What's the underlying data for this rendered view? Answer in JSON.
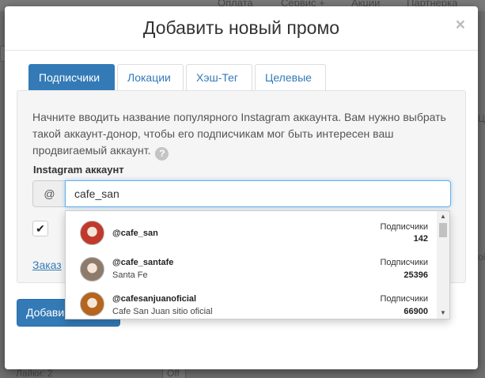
{
  "background": {
    "nav": [
      "Оплата",
      "Сервис +",
      "Акции",
      "Партнерка"
    ],
    "row_label": "Лайки: 2",
    "row_value": "Off",
    "side_fragment_1": "Ц",
    "side_fragment_2": "ой"
  },
  "modal": {
    "title": "Добавить новый промо",
    "close": "×"
  },
  "tabs": [
    {
      "label": "Подписчики",
      "active": true
    },
    {
      "label": "Локации",
      "active": false
    },
    {
      "label": "Хэш-Тег",
      "active": false
    },
    {
      "label": "Целевые",
      "active": false
    }
  ],
  "form": {
    "help_text": "Начните вводить название популярного Instagram аккаунта. Вам нужно выбрать такой аккаунт-донор, чтобы его подписчикам мог быть интересен ваш продвигаемый аккаунт.",
    "help_icon": "?",
    "field_label": "Instagram аккаунт",
    "addon": "@",
    "input_value": "cafe_san",
    "checkbox_mark": "✔",
    "link_text": "Заказ",
    "submit_label": "Добави"
  },
  "suggestions": [
    {
      "username": "@cafe_san",
      "name": "",
      "subscribers_label": "Подписчики",
      "subscribers": "142",
      "avatar_color": "#c0392b"
    },
    {
      "username": "@cafe_santafe",
      "name": "Santa Fe",
      "subscribers_label": "Подписчики",
      "subscribers": "25396",
      "avatar_color": "#8e7b6b"
    },
    {
      "username": "@cafesanjuanoficial",
      "name": "Cafe San Juan sitio oficial",
      "subscribers_label": "Подписчики",
      "subscribers": "66900",
      "avatar_color": "#b5651d"
    }
  ],
  "colors": {
    "primary": "#337ab7",
    "focus": "#66afe9"
  }
}
